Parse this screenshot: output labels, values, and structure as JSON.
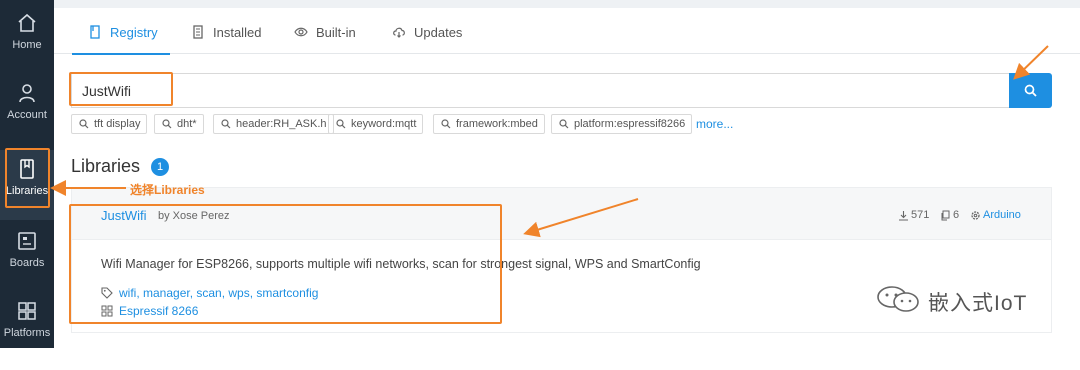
{
  "sidebar": {
    "items": [
      {
        "label": "Home",
        "icon": "home-icon"
      },
      {
        "label": "Account",
        "icon": "user-icon"
      },
      {
        "label": "Libraries",
        "icon": "book-icon"
      },
      {
        "label": "Boards",
        "icon": "board-icon"
      },
      {
        "label": "Platforms",
        "icon": "grid-icon"
      }
    ],
    "active": "Libraries"
  },
  "tabs": [
    {
      "label": "Registry",
      "icon": "bookmark-icon",
      "active": true
    },
    {
      "label": "Installed",
      "icon": "document-icon",
      "active": false
    },
    {
      "label": "Built-in",
      "icon": "eye-icon",
      "active": false
    },
    {
      "label": "Updates",
      "icon": "cloud-download-icon",
      "active": false
    }
  ],
  "search": {
    "value": "JustWifi"
  },
  "quick_filters": [
    "tft display",
    "dht*",
    "header:RH_ASK.h",
    "keyword:mqtt",
    "framework:mbed",
    "platform:espressif8266"
  ],
  "more_label": "more...",
  "libraries": {
    "title": "Libraries",
    "count": "1",
    "items": [
      {
        "name": "JustWifi",
        "author": "by Xose Perez",
        "downloads": "571",
        "examples": "6",
        "framework": "Arduino",
        "description": "Wifi Manager for ESP8266, supports multiple wifi networks, scan for strongest signal, WPS and SmartConfig",
        "keywords": "wifi, manager, scan, wps, smartconfig",
        "platform": "Espressif 8266"
      }
    ]
  },
  "annotation": {
    "text": "选择Libraries",
    "color": "#f0842b"
  },
  "watermark": {
    "text": "嵌入式IoT"
  },
  "colors": {
    "accent": "#1e8fe1",
    "sidebar": "#1d2a37",
    "annotation": "#f0842b"
  }
}
